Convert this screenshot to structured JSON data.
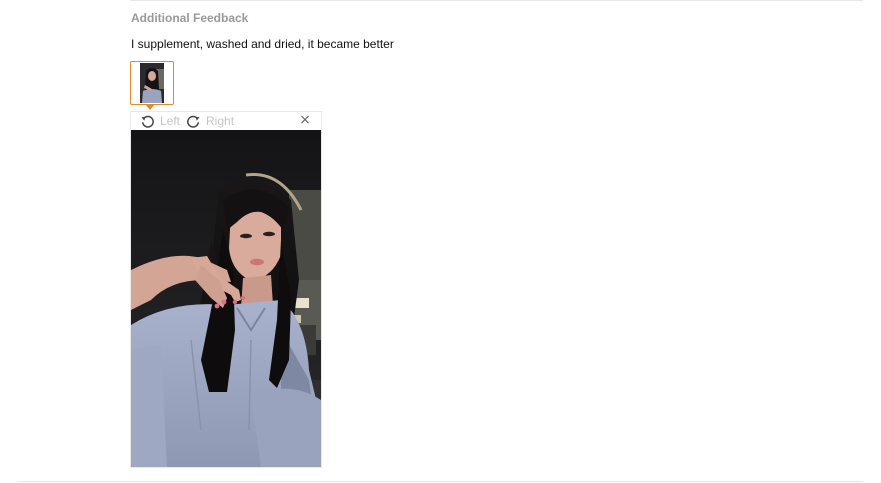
{
  "feedback": {
    "heading": "Additional Feedback",
    "text": "I supplement, washed and dried, it became better"
  },
  "thumbnail": {
    "icon": "photo-thumbnail",
    "selected_border_color": "#e38b2c"
  },
  "viewer": {
    "rotate_left_label": "Left",
    "rotate_right_label": "Right",
    "close_symbol": "×",
    "icons": {
      "rotate_left": "rotate-left-icon",
      "rotate_right": "rotate-right-icon",
      "close": "close-icon"
    }
  },
  "colors": {
    "accent": "#e38b2c",
    "heading": "#999999",
    "disabled_text": "#c4c4c4",
    "body_text": "#111111"
  }
}
